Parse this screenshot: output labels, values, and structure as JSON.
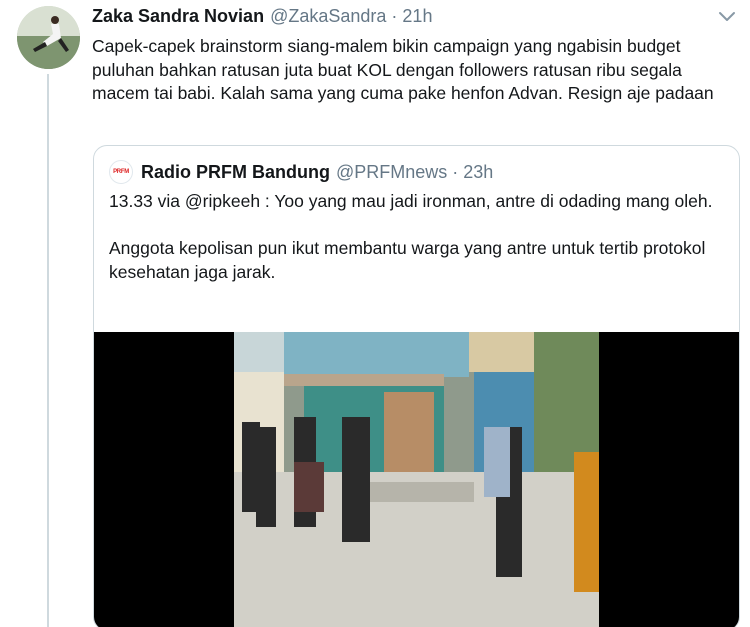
{
  "tweet": {
    "author_name": "Zaka Sandra Novian",
    "handle": "@ZakaSandra",
    "separator": "·",
    "time": "21h",
    "text": "Capek-capek brainstorm siang-malem bikin campaign yang ngabisin budget puluhan bahkan ratusan juta buat KOL dengan followers ratusan ribu segala macem tai babi. Kalah sama yang cuma pake henfon Advan. Resign aje padaan",
    "menu_icon": "chevron-down-icon"
  },
  "quoted": {
    "author_name": "Radio PRFM Bandung",
    "handle": "@PRFMnews",
    "separator": "·",
    "time": "23h",
    "avatar_text": "PRFM",
    "paragraph_1": "13.33 via @ripkeeh : Yoo yang mau jadi ironman, antre di odading mang oleh.",
    "paragraph_2": "Anggota kepolisan pun ikut membantu warga yang antre untuk tertib protokol kesehatan jaga jarak."
  },
  "colors": {
    "text": "#14171a",
    "secondary": "#657786",
    "border": "#cfd9de"
  }
}
